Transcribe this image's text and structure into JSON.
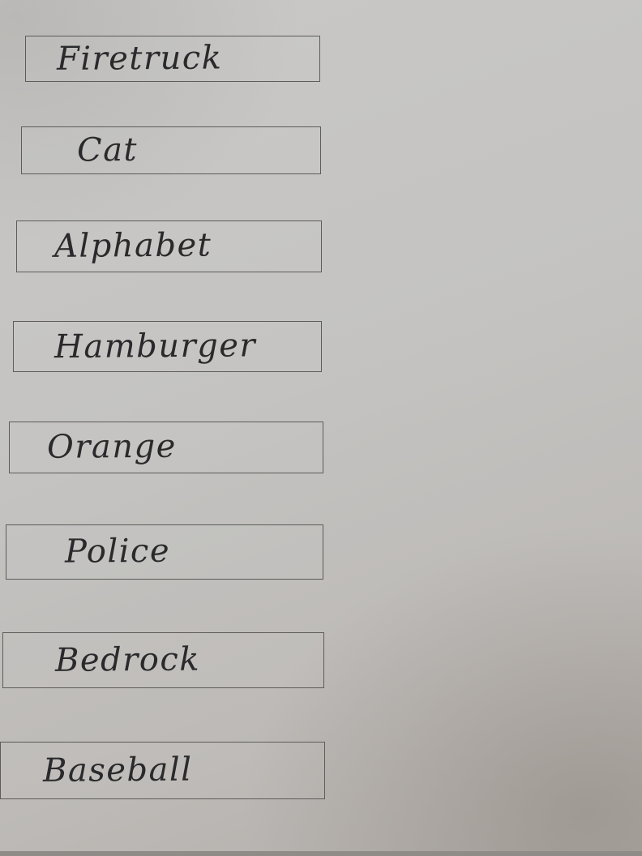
{
  "word_boxes": [
    {
      "text": "Firetruck"
    },
    {
      "text": "Cat"
    },
    {
      "text": "Alphabet"
    },
    {
      "text": "Hamburger"
    },
    {
      "text": "Orange"
    },
    {
      "text": "Police"
    },
    {
      "text": "Bedrock"
    },
    {
      "text": "Baseball"
    }
  ]
}
